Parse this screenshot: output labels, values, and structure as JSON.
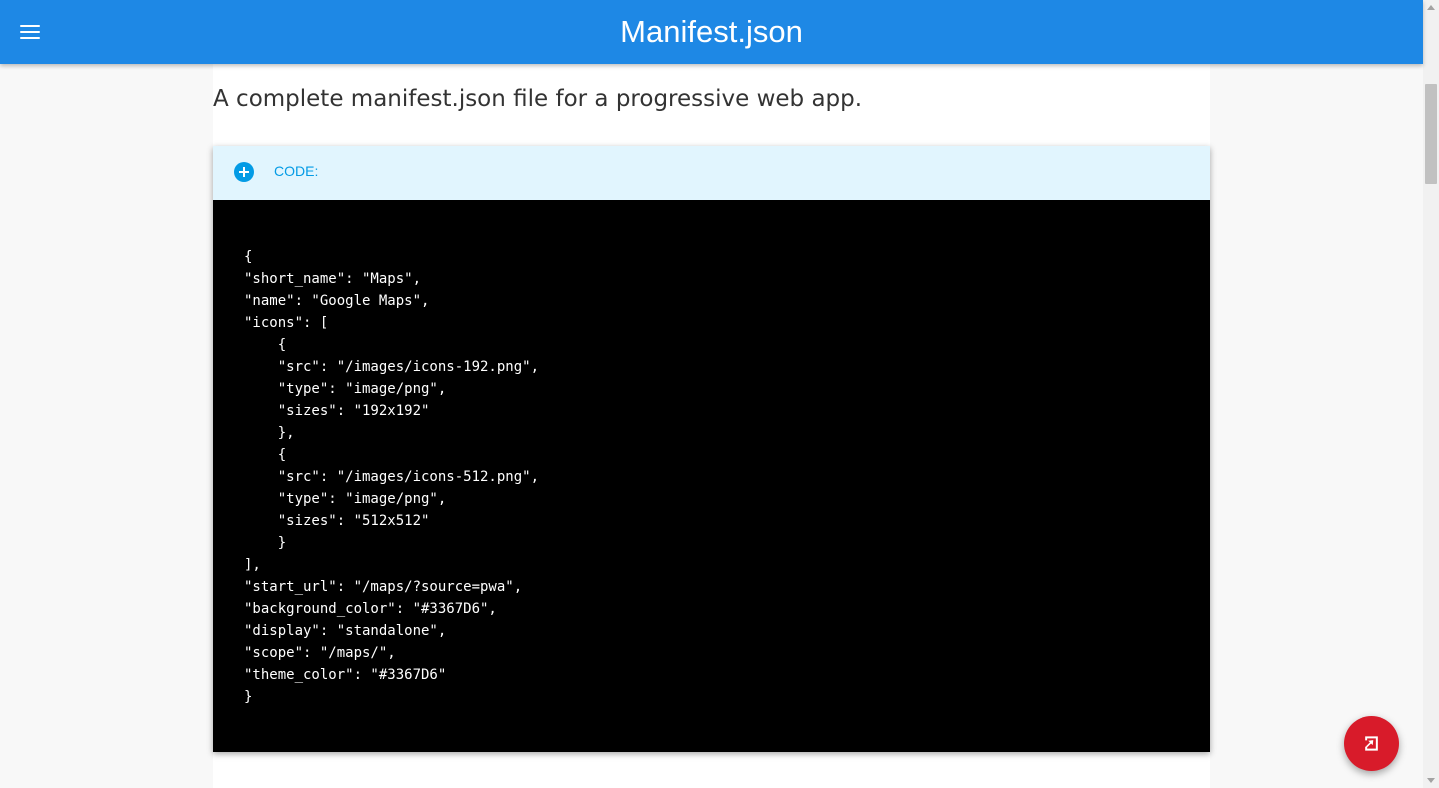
{
  "header": {
    "title": "Manifest.json",
    "menu_icon": "menu-icon"
  },
  "main": {
    "description": "A complete manifest.json file for a progressive web app.",
    "code_section": {
      "label": "CODE:",
      "toggle_icon": "add-circle-icon",
      "lines": [
        "{",
        "\"short_name\": \"Maps\",",
        "\"name\": \"Google Maps\",",
        "\"icons\": [",
        "    {",
        "    \"src\": \"/images/icons-192.png\",",
        "    \"type\": \"image/png\",",
        "    \"sizes\": \"192x192\"",
        "    },",
        "    {",
        "    \"src\": \"/images/icons-512.png\",",
        "    \"type\": \"image/png\",",
        "    \"sizes\": \"512x512\"",
        "    }",
        "],",
        "\"start_url\": \"/maps/?source=pwa\",",
        "\"background_color\": \"#3367D6\",",
        "\"display\": \"standalone\",",
        "\"scope\": \"/maps/\",",
        "\"theme_color\": \"#3367D6\"",
        "}"
      ]
    }
  },
  "fab": {
    "icon": "exit-to-app-icon"
  },
  "colors": {
    "app_bar": "#1e88e5",
    "code_header_bg": "#e1f5fe",
    "code_header_text": "#039be5",
    "code_bg": "#000000",
    "fab": "#d81b2a"
  }
}
